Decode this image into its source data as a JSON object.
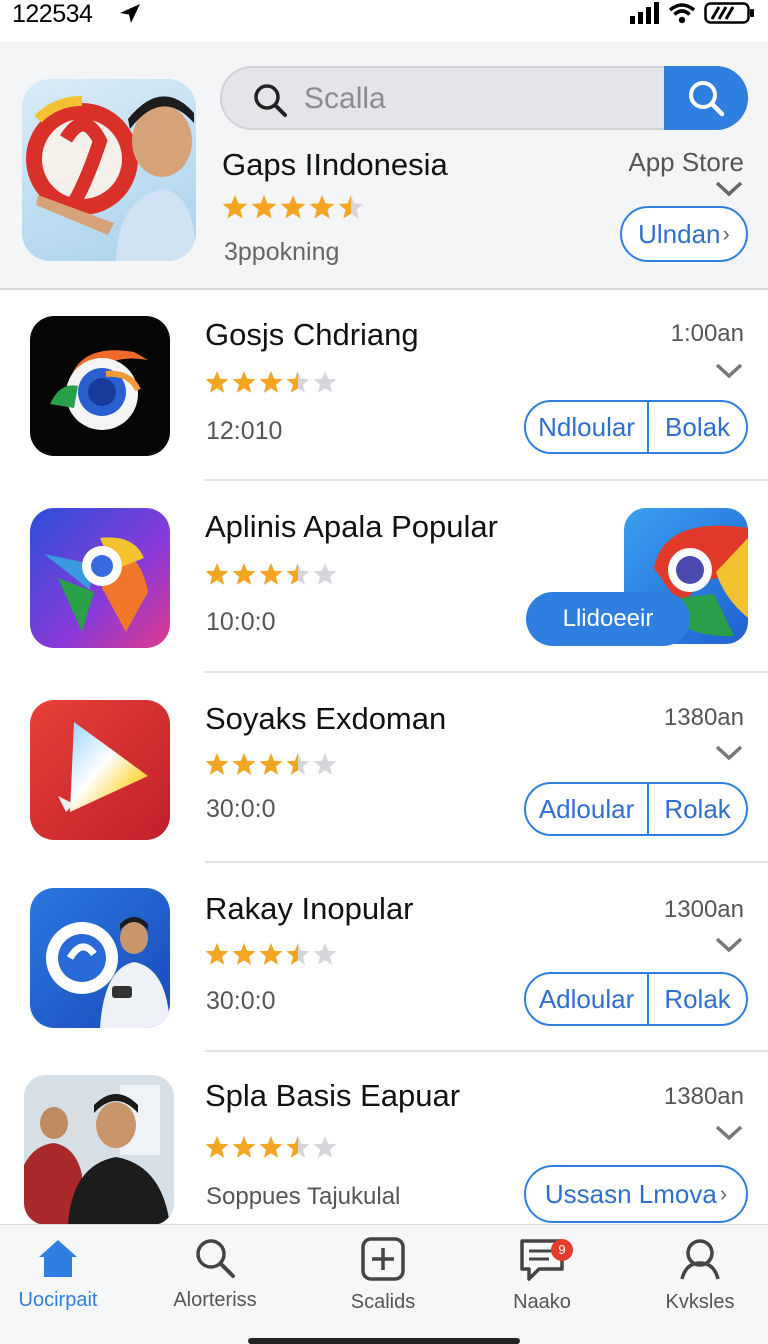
{
  "status": {
    "time": "122534"
  },
  "colors": {
    "accent": "#2f7fe0",
    "star": "#f4a623",
    "badge": "#e23c2a"
  },
  "search": {
    "text": "Scalla"
  },
  "featured": {
    "title": "Gaps IIndonesia",
    "store": "App Store",
    "rating": 4.5,
    "subtitle": "3ppokning",
    "action": "Ulndan"
  },
  "apps": [
    {
      "title": "Gosjs Chdriang",
      "rating": 3.5,
      "meta": "12:010",
      "time": "1:00an",
      "btn1": "Ndloular",
      "btn2": "Bolak",
      "icon": "chrome-like-icon"
    },
    {
      "title": "Aplinis Apala Popular",
      "rating": 3.5,
      "meta": "10:0:0",
      "install": "Llidoeeir",
      "icon": "maps-like-icon"
    },
    {
      "title": "Soyaks Exdoman",
      "rating": 3.5,
      "meta": "30:0:0",
      "time": "1380an",
      "btn1": "Adloular",
      "btn2": "Rolak",
      "icon": "play-like-icon"
    },
    {
      "title": "Rakay Inopular",
      "rating": 3.5,
      "meta": "30:0:0",
      "time": "1300an",
      "btn1": "Adloular",
      "btn2": "Rolak",
      "icon": "person-app-icon"
    },
    {
      "title": "Spla Basis Eapuar",
      "rating": 3.5,
      "meta": "Soppues Tajukulal",
      "time": "1380an",
      "action": "Ussasn Lmova",
      "icon": "people-photo-icon"
    }
  ],
  "tabs": [
    {
      "label": "Uocirpait",
      "icon": "home-icon",
      "active": true
    },
    {
      "label": "Alorteriss",
      "icon": "search-icon"
    },
    {
      "label": "Scalids",
      "icon": "add-icon"
    },
    {
      "label": "Naako",
      "icon": "message-icon",
      "badge": "9"
    },
    {
      "label": "Kvksles",
      "icon": "profile-icon"
    }
  ]
}
